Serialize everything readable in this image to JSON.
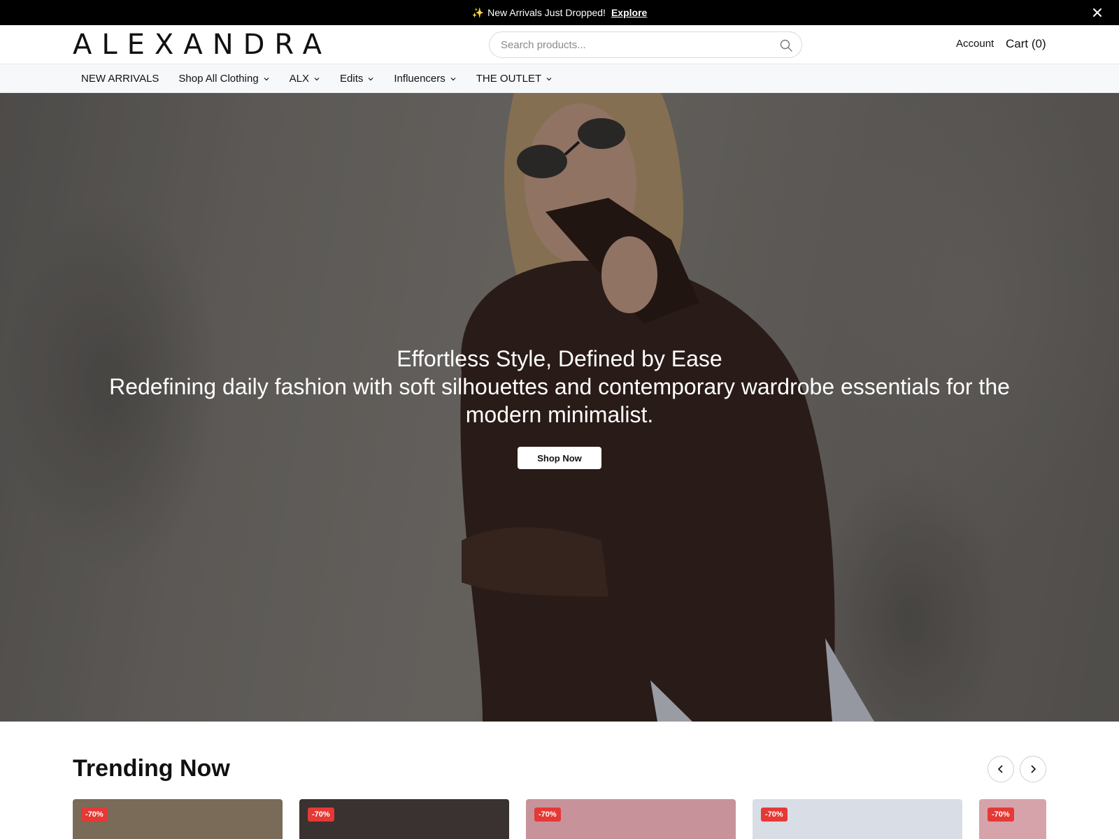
{
  "announcement": {
    "sparkle": "✨",
    "message": "New Arrivals Just Dropped!",
    "link": "Explore"
  },
  "header": {
    "logo": "ALEXANDRA",
    "search_placeholder": "Search products...",
    "account": "Account",
    "cart": "Cart (0)"
  },
  "nav": {
    "items": [
      {
        "label": "NEW ARRIVALS",
        "has_dropdown": false
      },
      {
        "label": "Shop All Clothing",
        "has_dropdown": true
      },
      {
        "label": "ALX",
        "has_dropdown": true
      },
      {
        "label": "Edits",
        "has_dropdown": true
      },
      {
        "label": "Influencers",
        "has_dropdown": true
      },
      {
        "label": "THE OUTLET",
        "has_dropdown": true
      }
    ]
  },
  "hero": {
    "title": "Effortless Style, Defined by Ease",
    "subtitle": "Redefining daily fashion with soft silhouettes and contemporary wardrobe essentials for the modern minimalist.",
    "cta": "Shop Now"
  },
  "trending": {
    "title": "Trending Now",
    "prev_icon": "chevron-left-icon",
    "next_icon": "chevron-right-icon",
    "products": [
      {
        "badge": "-70%",
        "tone": "#7a6a58"
      },
      {
        "badge": "-70%",
        "tone": "#3a3230"
      },
      {
        "badge": "-70%",
        "tone": "#c8929a"
      },
      {
        "badge": "-70%",
        "tone": "#d9dde6"
      },
      {
        "badge": "-70%",
        "tone": "#d6a3ab"
      }
    ]
  },
  "colors": {
    "announcement_bg": "#000000",
    "badge": "#e53935",
    "nav_bg": "#f7f8fa"
  }
}
